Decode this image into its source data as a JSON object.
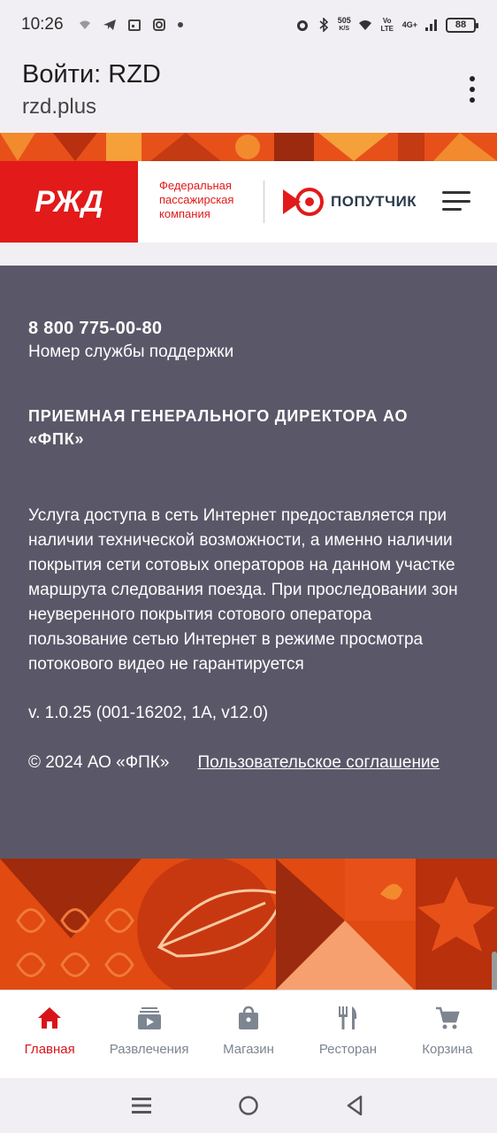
{
  "status_bar": {
    "time": "10:26",
    "net_speed": "505",
    "net_speed_unit": "K/S",
    "volte": "Vo LTE",
    "network": "4G+",
    "battery": "88"
  },
  "browser": {
    "title": "Войти: RZD",
    "url": "rzd.plus"
  },
  "header": {
    "logo_text": "РЖД",
    "fpk_line1": "Федеральная",
    "fpk_line2": "пассажирская",
    "fpk_line3": "компания",
    "poputchik": "ПОПУТЧИК"
  },
  "footer": {
    "support_phone": "8 800 775-00-80",
    "support_label": "Номер службы поддержки",
    "reception": "ПРИЕМНАЯ ГЕНЕРАЛЬНОГО ДИРЕКТОРА АО «ФПК»",
    "disclaimer": "Услуга доступа в сеть Интернет предоставляется при наличии технической возможности, а именно наличии покрытия сети сотовых операторов на данном участке маршрута следования поезда. При проследовании зон неуверенного покрытия сотового оператора пользование сетью Интернет в режиме просмотра потокового видео не гарантируется",
    "version": "v. 1.0.25 (001-16202, 1A, v12.0)",
    "copyright": "© 2024 АО «ФПК»",
    "agreement": "Пользовательское соглашение"
  },
  "bottom_nav": [
    {
      "label": "Главная",
      "icon": "home-icon",
      "active": true
    },
    {
      "label": "Развлечения",
      "icon": "media-icon",
      "active": false
    },
    {
      "label": "Магазин",
      "icon": "bag-icon",
      "active": false
    },
    {
      "label": "Ресторан",
      "icon": "cutlery-icon",
      "active": false
    },
    {
      "label": "Корзина",
      "icon": "cart-icon",
      "active": false
    }
  ],
  "colors": {
    "brand_red": "#e21a1a",
    "footer_bg": "#5a5868",
    "pattern_orange": "#e8501a",
    "active_nav": "#d8141b",
    "inactive_nav": "#7d8590"
  }
}
